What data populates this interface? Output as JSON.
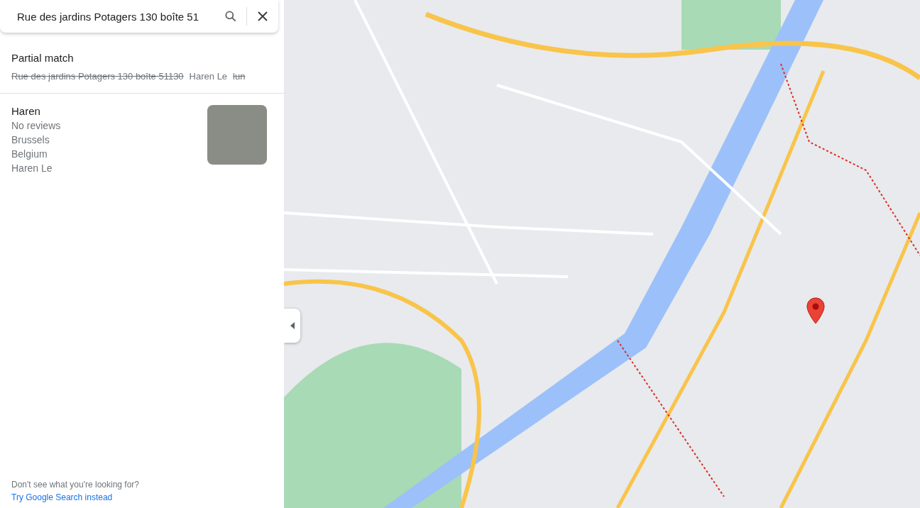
{
  "search": {
    "value": "Rue des jardins Potagers 130 boîte 51"
  },
  "partial_match": {
    "title": "Partial match",
    "terms": [
      {
        "text": "Rue des jardins Potagers 130 boîte 51130",
        "matched": false
      },
      {
        "text": "Haren Le",
        "matched": true
      },
      {
        "text": "lun",
        "matched": false
      }
    ]
  },
  "result": {
    "name": "Haren",
    "details": [
      "No reviews",
      "Brussels",
      "Belgium",
      "Haren Le"
    ]
  },
  "footer": {
    "prompt": "Don't see what you're looking for?",
    "link": "Try Google Search instead"
  }
}
